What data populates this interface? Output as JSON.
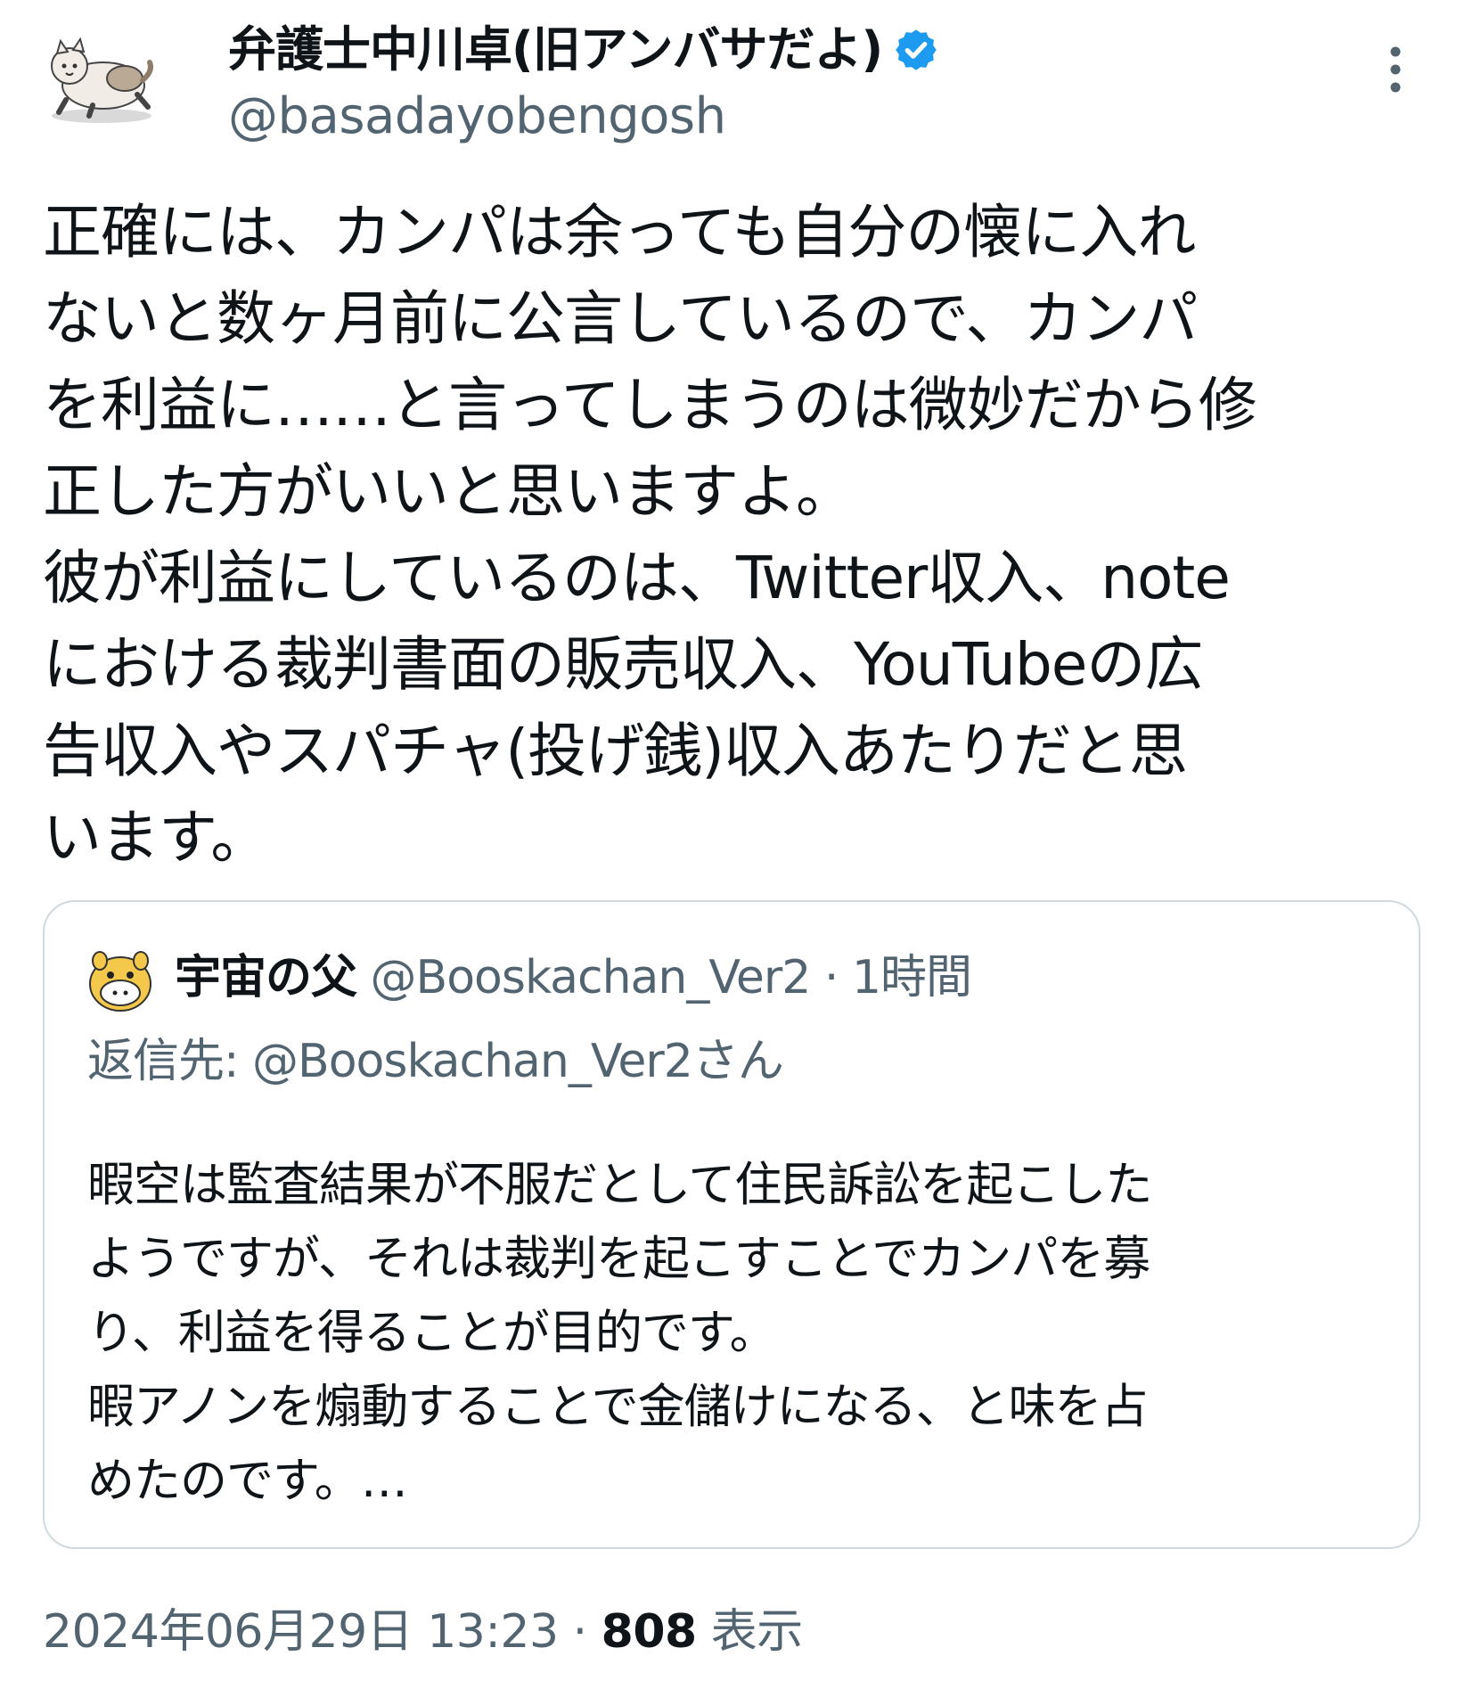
{
  "author": {
    "display_name": "弁護士中川卓(旧アンバサだよ)",
    "handle": "@basadayobengosh",
    "verified_icon": "verified-badge-icon",
    "avatar_icon": "cat-avatar-icon"
  },
  "tweet": {
    "text": "正確には、カンパは余っても自分の懐に入れ\nないと数ヶ月前に公言しているので、カンパ\nを利益に……と言ってしまうのは微妙だから修\n正した方がいいと思いますよ。\n彼が利益にしているのは、Twitter収入、note\nにおける裁判書面の販売収入、YouTubeの広\n告収入やスパチャ(投げ銭)収入あたりだと思\nいます。"
  },
  "quote": {
    "display_name": "宇宙の父",
    "meta": " @Booskachan_Ver2 · 1時間",
    "reply_to": "返信先: @Booskachan_Ver2さん",
    "text": "暇空は監査結果が不服だとして住民訴訟を起こした\nようですが、それは裁判を起こすことでカンパを募\nり、利益を得ることが目的です。\n暇アノンを煽動することで金儲けになる、と味を占\nめたのです。…",
    "avatar_icon": "yellow-mascot-avatar-icon"
  },
  "footer": {
    "datetime": "2024年06月29日 13:23 · ",
    "views_count": "808",
    "views_label": " 表示"
  },
  "colors": {
    "text_primary": "#0f1419",
    "text_secondary": "#536471",
    "verified_blue": "#1d9bf0",
    "card_border": "#cfd9de"
  }
}
